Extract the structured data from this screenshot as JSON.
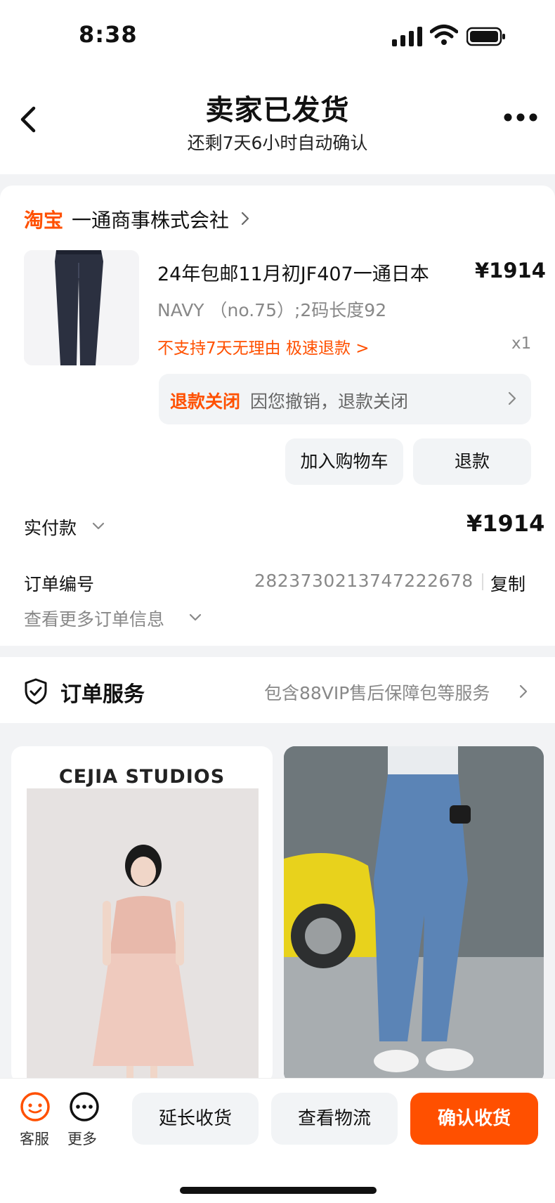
{
  "status_bar": {
    "time": "8:38"
  },
  "header": {
    "title": "卖家已发货",
    "subtitle": "还剩7天6小时自动确认"
  },
  "shop": {
    "brand": "淘宝",
    "name": "一通商事株式会社"
  },
  "product": {
    "title": "24年包邮11月初JF407一通日本",
    "price": "¥1914",
    "sku": "NAVY （no.75）;2码长度92",
    "policy": "不支持7天无理由  极速退款 >",
    "quantity": "x1"
  },
  "refund": {
    "status": "退款关闭",
    "description": "因您撤销，退款关闭"
  },
  "actions": {
    "add_to_cart": "加入购物车",
    "refund": "退款"
  },
  "payment": {
    "label": "实付款",
    "amount": "¥1914"
  },
  "order": {
    "label": "订单编号",
    "number": "2823730213747222678",
    "copy": "复制",
    "more_info": "查看更多订单信息"
  },
  "services": {
    "title": "订单服务",
    "description": "包含88VIP售后保障包等服务"
  },
  "recommendations": {
    "left_brand": "CEJIA STUDIOS"
  },
  "bottom_bar": {
    "customer_service": "客服",
    "more": "更多",
    "extend": "延长收货",
    "logistics": "查看物流",
    "confirm": "确认收货"
  },
  "colors": {
    "accent": "#ff5000",
    "muted_text": "#888888",
    "button_bg": "#f2f4f6"
  }
}
